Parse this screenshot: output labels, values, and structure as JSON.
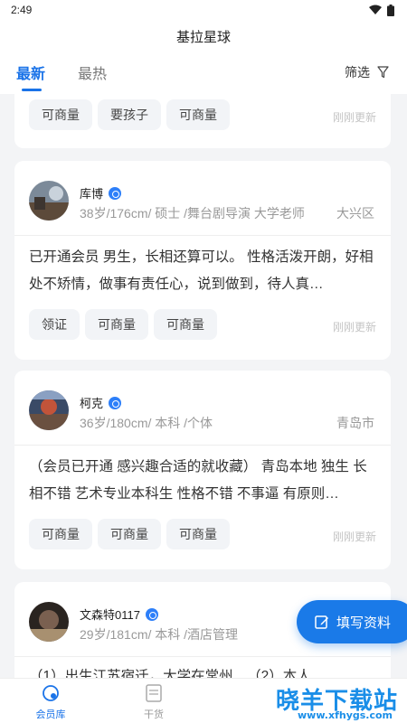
{
  "status_bar": {
    "time": "2:49"
  },
  "header": {
    "title": "基拉星球"
  },
  "tabs": [
    {
      "label": "最新",
      "active": true
    },
    {
      "label": "最热",
      "active": false
    }
  ],
  "filter": {
    "label": "筛选",
    "icon": "filter-icon"
  },
  "cards": [
    {
      "partial": true,
      "tags": [
        "可商量",
        "要孩子",
        "可商量"
      ],
      "updated": "刚刚更新"
    },
    {
      "name": "库博",
      "meta": "38岁/176cm/ 硕士 /舞台剧导演 大学老师",
      "city": "大兴区",
      "description": "已开通会员 男生，长相还算可以。 性格活泼开朗，好相处不矫情，做事有责任心，说到做到，待人真…",
      "tags": [
        "领证",
        "可商量",
        "可商量"
      ],
      "updated": "刚刚更新"
    },
    {
      "name": "柯克",
      "meta": "36岁/180cm/ 本科 /个体",
      "city": "青岛市",
      "description": "（会员已开通 感兴趣合适的就收藏） 青岛本地 独生 长相不错 艺术专业本科生 性格不错 不事逼 有原则…",
      "tags": [
        "可商量",
        "可商量",
        "可商量"
      ],
      "updated": "刚刚更新"
    },
    {
      "name": "文森特0117",
      "meta": "29岁/181cm/ 本科 /酒店管理",
      "city": "",
      "description": "（1）出生江苏宿迁，大学在常州…（2）本人",
      "tags": [],
      "updated": ""
    }
  ],
  "fab": {
    "label": "填写资料",
    "icon": "edit-icon"
  },
  "bottom_nav": [
    {
      "label": "会员库",
      "icon": "member-library-icon",
      "active": true
    },
    {
      "label": "干货",
      "icon": "article-icon",
      "active": false
    }
  ],
  "watermark": {
    "title": "晓羊下载站",
    "url": "www.xfhygs.com"
  },
  "colors": {
    "accent": "#1a73e8",
    "fab": "#1a7ae8",
    "background": "#f3f4f6"
  }
}
